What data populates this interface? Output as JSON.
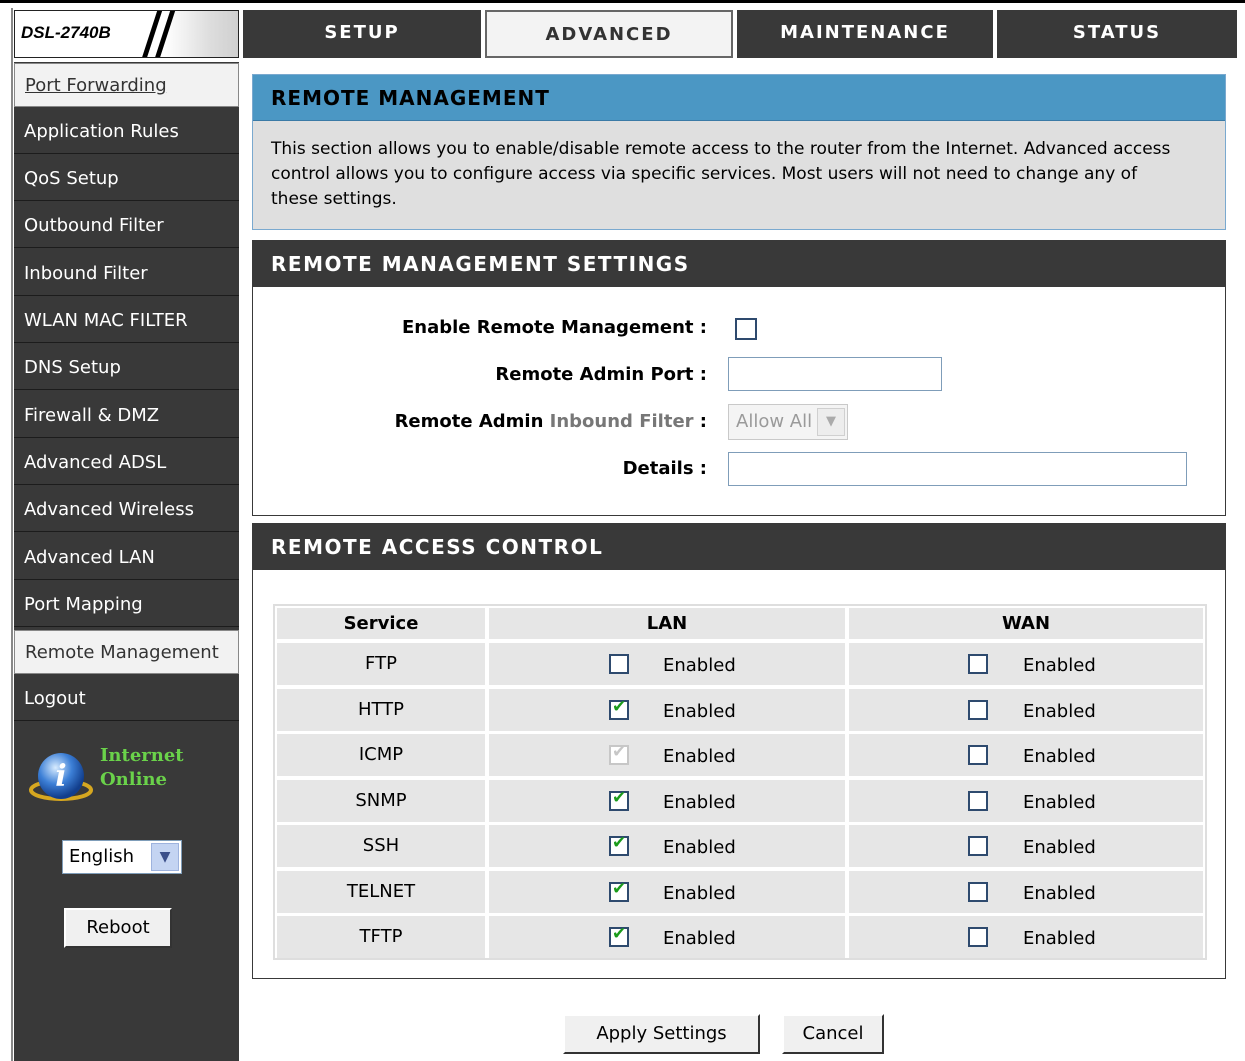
{
  "header": {
    "model": "DSL-2740B",
    "tabs": [
      {
        "label": "SETUP"
      },
      {
        "label": "ADVANCED"
      },
      {
        "label": "MAINTENANCE"
      },
      {
        "label": "STATUS"
      }
    ]
  },
  "sidebar": {
    "items": [
      {
        "label": "Port Forwarding"
      },
      {
        "label": "Application Rules"
      },
      {
        "label": "QoS Setup"
      },
      {
        "label": "Outbound Filter"
      },
      {
        "label": "Inbound Filter"
      },
      {
        "label": "WLAN MAC FILTER"
      },
      {
        "label": "DNS Setup"
      },
      {
        "label": "Firewall & DMZ"
      },
      {
        "label": "Advanced ADSL"
      },
      {
        "label": "Advanced Wireless"
      },
      {
        "label": "Advanced LAN"
      },
      {
        "label": "Port Mapping"
      },
      {
        "label": "Remote Management"
      },
      {
        "label": "Logout"
      }
    ],
    "status_line1": "Internet",
    "status_line2": "Online",
    "language": "English",
    "reboot_label": "Reboot"
  },
  "intro": {
    "title": "REMOTE MANAGEMENT",
    "description": "This section allows you to enable/disable remote access to the router from the Internet. Advanced access control allows you to configure access via specific services. Most users will not need to change any of these settings."
  },
  "settings": {
    "title": "REMOTE MANAGEMENT SETTINGS",
    "enable_label": "Enable Remote Management :",
    "enable_checked": false,
    "port_label": "Remote Admin Port :",
    "port_value": "",
    "filter_label_a": "Remote Admin ",
    "filter_label_b": "Inbound Filter",
    "filter_label_c": " :",
    "filter_value": "Allow All",
    "details_label": "Details :",
    "details_value": ""
  },
  "access": {
    "title": "REMOTE ACCESS CONTROL",
    "headers": {
      "service": "Service",
      "lan": "LAN",
      "wan": "WAN"
    },
    "enabled_label": "Enabled",
    "rows": [
      {
        "service": "FTP",
        "lan": false,
        "lan_disabled": false,
        "wan": false
      },
      {
        "service": "HTTP",
        "lan": true,
        "lan_disabled": false,
        "wan": false
      },
      {
        "service": "ICMP",
        "lan": true,
        "lan_disabled": true,
        "wan": false
      },
      {
        "service": "SNMP",
        "lan": true,
        "lan_disabled": false,
        "wan": false
      },
      {
        "service": "SSH",
        "lan": true,
        "lan_disabled": false,
        "wan": false
      },
      {
        "service": "TELNET",
        "lan": true,
        "lan_disabled": false,
        "wan": false
      },
      {
        "service": "TFTP",
        "lan": true,
        "lan_disabled": false,
        "wan": false
      }
    ]
  },
  "actions": {
    "apply_label": "Apply Settings",
    "cancel_label": "Cancel"
  },
  "colors": {
    "dark": "#393939",
    "accent_blue": "#4b97c4",
    "online_green": "#6ad24a"
  }
}
